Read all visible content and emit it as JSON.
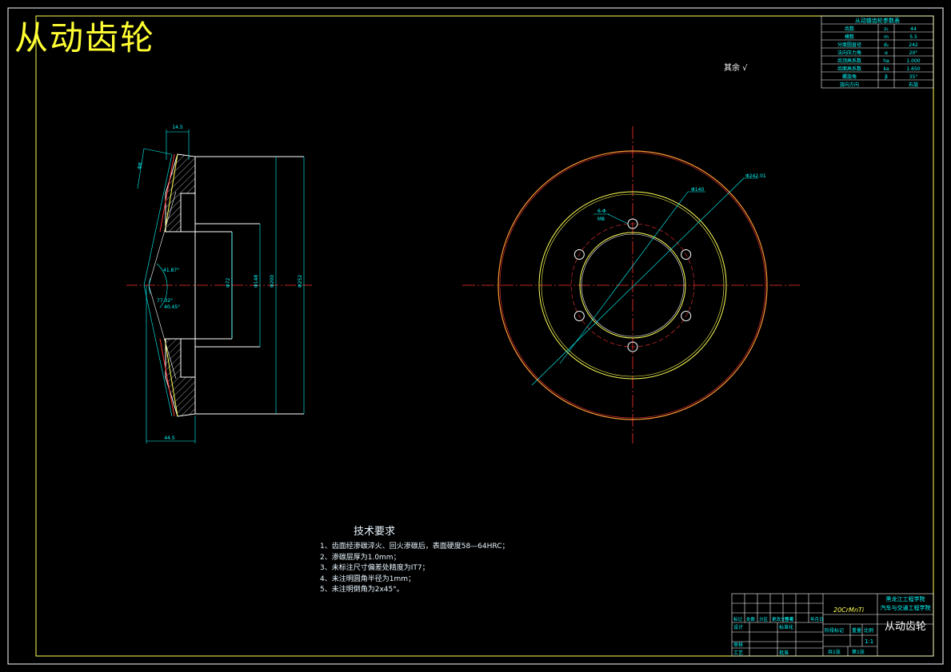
{
  "title": "从动齿轮",
  "surface_finish_mark": "其余 √",
  "params_table": {
    "header": "从动锥齿轮参数表",
    "rows": [
      {
        "name": "齿数",
        "symbol": "z₂",
        "value": "44"
      },
      {
        "name": "模数",
        "symbol": "m",
        "value": "5.5"
      },
      {
        "name": "分度圆直径",
        "symbol": "d₂",
        "value": "242"
      },
      {
        "name": "法向压力角",
        "symbol": "α",
        "value": "20°"
      },
      {
        "name": "齿顶高系数",
        "symbol": "ha",
        "value": "1.000"
      },
      {
        "name": "齿面高系数",
        "symbol": "ka",
        "value": "1.650"
      },
      {
        "name": "螺旋角",
        "symbol": "β",
        "value": "35°"
      },
      {
        "name": "旋向方向",
        "symbol": "",
        "value": "右旋"
      }
    ]
  },
  "section_view": {
    "dims": [
      "14.5",
      "Φ8",
      "41.87°",
      "77.32°",
      "40.45°",
      "Φ72",
      "Φ148",
      "Φ200",
      "Φ252",
      "44.5"
    ]
  },
  "front_view": {
    "dims": [
      "Φ242.01",
      "Φ140",
      "6-Φ",
      "M8"
    ]
  },
  "tech_req": {
    "title": "技术要求",
    "items": [
      "1、齿面经渗碳淬火、回火渗碳后，表面硬度58—64HRC；",
      "2、渗碳层厚为1.0mm；",
      "3、未标注尺寸偏差处精度为IT7；",
      "4、未注明圆角半径为1mm；",
      "5、未注明倒角为2x45°。"
    ]
  },
  "title_block": {
    "material": "20CrMnTi",
    "school": "黑龙江工程学院",
    "dept": "汽车与交通工程学院",
    "part_name": "从动齿轮",
    "header_labels": [
      "标记",
      "处数",
      "分区",
      "更改文件号",
      "签名",
      "年月日"
    ],
    "row_labels": [
      "设计",
      "审核",
      "工艺",
      "标准化",
      "批准"
    ],
    "stage_labels": [
      "阶段标记",
      "重量",
      "比例"
    ],
    "scale": "1:1",
    "sheet_total": "共1张",
    "sheet_no": "第1张"
  },
  "colors": {
    "frame": "#ffff55",
    "dim": "#00ffff",
    "center": "#ff3333",
    "outline": "#ffffff",
    "title": "#ffff33"
  }
}
